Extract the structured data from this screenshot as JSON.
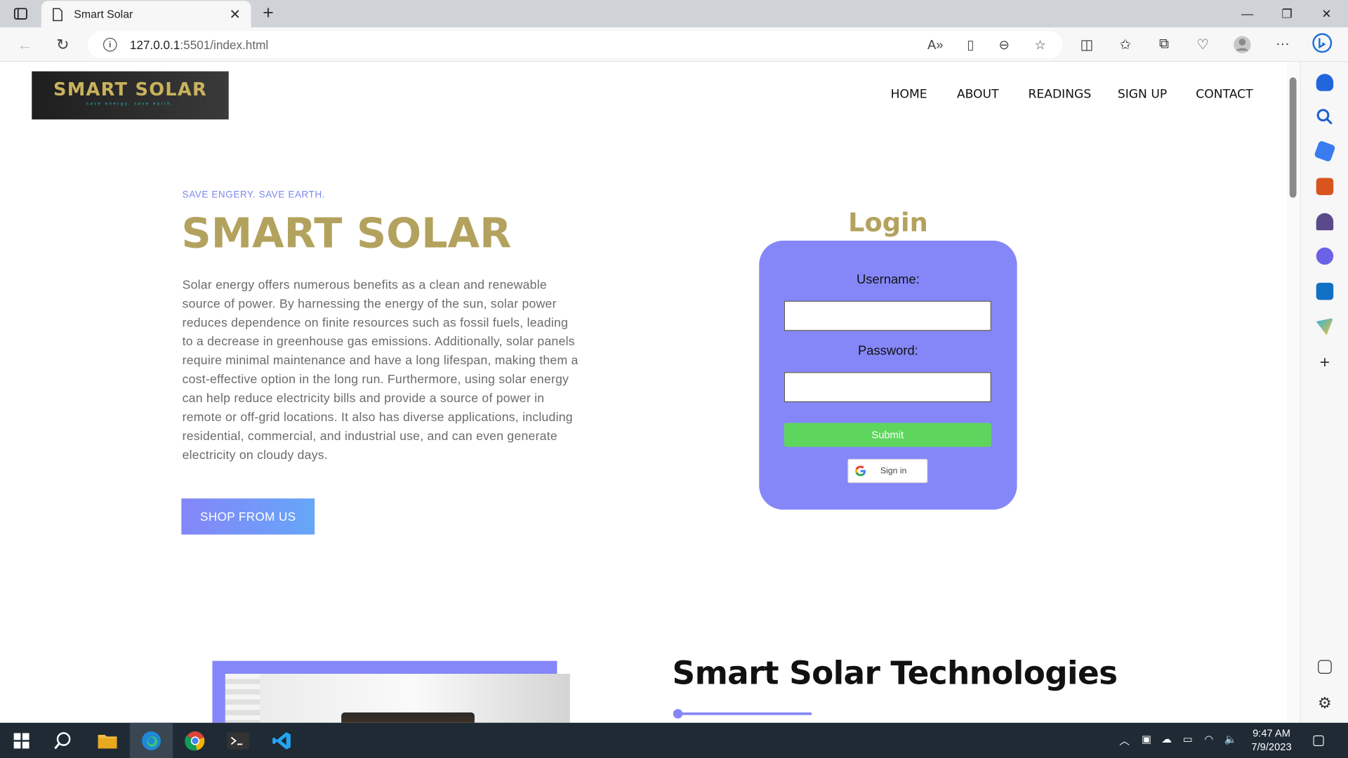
{
  "browser": {
    "tab_title": "Smart Solar",
    "url_host": "127.0.0.1",
    "url_rest": ":5501/index.html"
  },
  "site": {
    "logo_title": "SMART SOLAR",
    "logo_subtitle": "save energy. save earth.",
    "nav": [
      "HOME",
      "ABOUT",
      "READINGS",
      "SIGN UP",
      "CONTACT"
    ],
    "tagline": "SAVE ENGERY. SAVE EARTH.",
    "hero_title": "SMART SOLAR",
    "hero_text": "Solar energy offers numerous benefits as a clean and renewable source of power. By harnessing the energy of the sun, solar power reduces dependence on finite resources such as fossil fuels, leading to a decrease in greenhouse gas emissions. Additionally, solar panels require minimal maintenance and have a long lifespan, making them a cost-effective option in the long run. Furthermore, using solar energy can help reduce electricity bills and provide a source of power in remote or off-grid locations. It also has diverse applications, including residential, commercial, and industrial use, and can even generate electricity on cloudy days.",
    "shop_button": "SHOP FROM US",
    "section_title": "Smart Solar Technologies"
  },
  "login": {
    "title": "Login",
    "username_label": "Username:",
    "password_label": "Password:",
    "username_value": "",
    "password_value": "",
    "submit_label": "Submit",
    "google_label": "Sign in"
  },
  "taskbar": {
    "time": "9:47 AM",
    "date": "7/9/2023"
  },
  "colors": {
    "accent": "#8587f8",
    "gold": "#b3a25e",
    "submit_green": "#5ed65e"
  }
}
